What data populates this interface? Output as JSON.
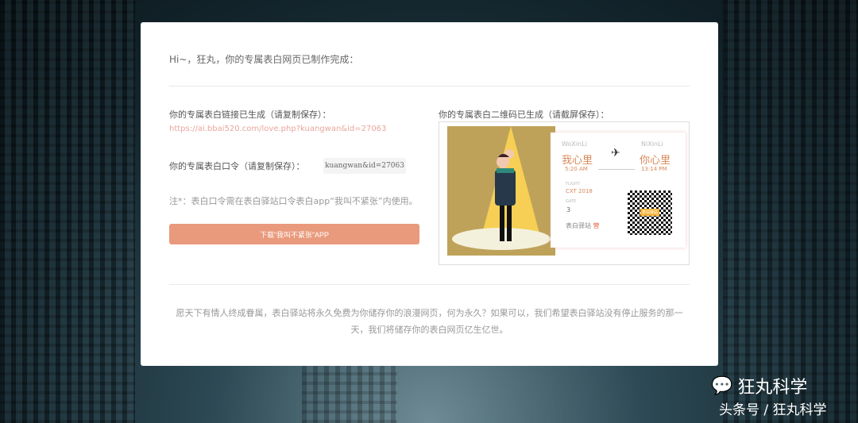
{
  "greeting": "Hi~，狂丸，你的专属表白网页已制作完成：",
  "link_section": {
    "label": "你的专属表白链接已生成（请复制保存）：",
    "url": "https://ai.bbai520.com/love.php?kuangwan&id=27063"
  },
  "code_section": {
    "label": "你的专属表白口令（请复制保存）：",
    "code": "kuangwan&id=27063"
  },
  "note": "注*：表白口令需在表白驿站口令表白app“我叫不紧张”内使用。",
  "download_button": "下载“我叫不紧张”APP",
  "qr_section": {
    "label": "你的专属表白二维码已生成（请截屏保存）：",
    "ticket": {
      "from_en": "WoXinLi",
      "to_en": "NiXinLi",
      "from": "我心里",
      "to": "你心里",
      "depart": "5:20 AM",
      "arrive": "13:14 PM",
      "flight_label": "FLIGHT",
      "flight": "CXT 2018",
      "gate_label": "GATE",
      "gate": "3",
      "brand": "表白驿站",
      "brand_mark": "营",
      "qr_badge": "表白驿站"
    }
  },
  "footer": "愿天下有情人终成眷属，表白驿站将永久免费为你储存你的浪漫网页，何为永久？如果可以，我们希望表白驿站没有停止服务的那一天，我们将储存你的表白网页亿生亿世。",
  "watermark": {
    "name": "狂丸科学",
    "sub": "头条号 / 狂丸科学"
  }
}
